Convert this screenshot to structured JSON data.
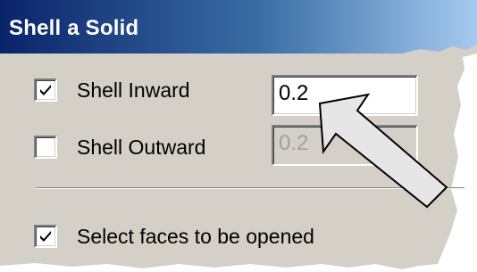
{
  "dialog": {
    "title": "Shell a Solid"
  },
  "options": {
    "shell_inward": {
      "label": "Shell Inward",
      "checked": true,
      "value": "0.2"
    },
    "shell_outward": {
      "label": "Shell Outward",
      "checked": false,
      "value": "0.2"
    },
    "select_faces": {
      "label": "Select faces to be opened",
      "checked": true
    }
  },
  "colors": {
    "title_gradient_start": "#0a246a",
    "title_gradient_end": "#a6caf0",
    "panel_face": "#d4d0c8",
    "arrow_fill": "#e6e6e6",
    "arrow_stroke": "#000000"
  },
  "icons": {
    "check": "check-mark-icon",
    "pointer": "callout-arrow-icon"
  }
}
